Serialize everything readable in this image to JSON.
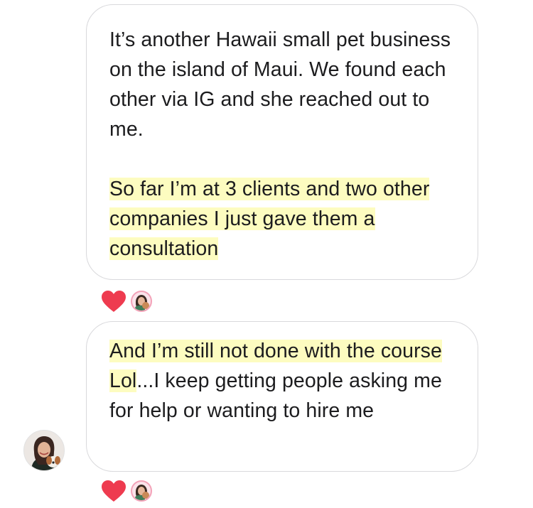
{
  "messages": [
    {
      "paragraphs": [
        {
          "text": "It’s another Hawaii small pet business on the island of Maui. We found each other via IG and she reached out to me.",
          "highlighted": false
        },
        {
          "text": "So far I’m at 3 clients and two other companies I just gave them a consultation",
          "highlighted": true
        }
      ],
      "reactions": [
        "heart-icon",
        "reactor-avatar"
      ]
    },
    {
      "paragraphs": [
        {
          "highlighted_text": "And I’m still not done with the course Lol",
          "text": "...I keep getting people asking me for help or wanting to hire me"
        }
      ],
      "reactions": [
        "heart-icon",
        "reactor-avatar"
      ]
    }
  ],
  "colors": {
    "highlight": "#fdfcc0",
    "heart": "#ee3b4f",
    "bubble_border": "#d9d9dc",
    "text": "#1c1c1e"
  }
}
